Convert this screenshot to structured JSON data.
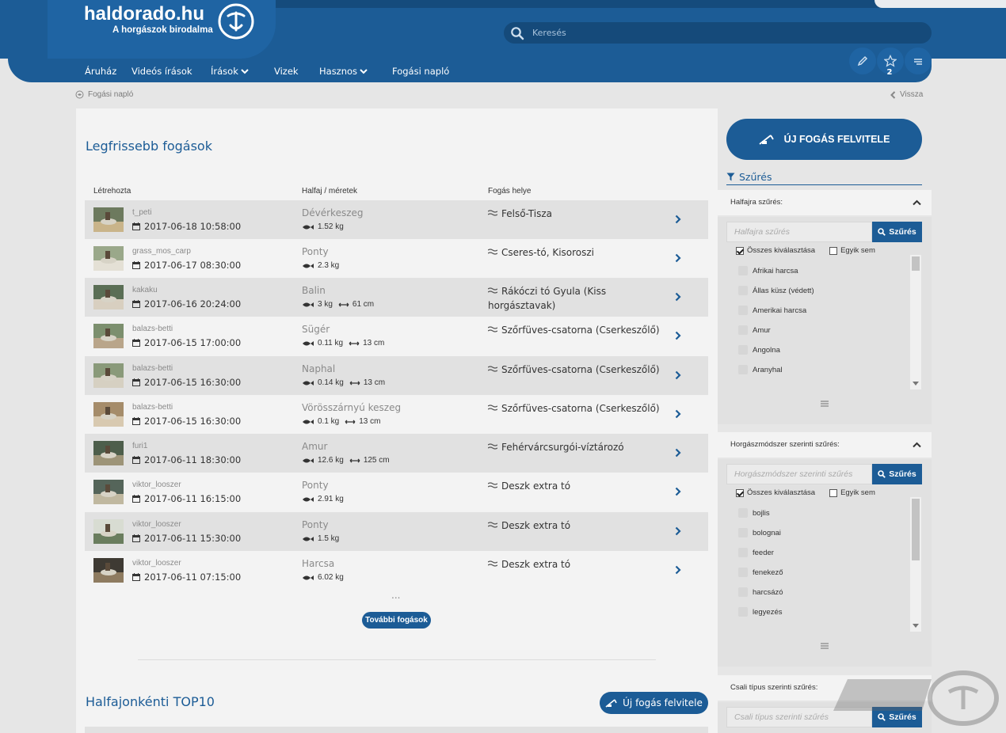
{
  "header": {
    "logo_text": "haldorado.hu",
    "logo_subtitle": "A horgászok birodalma",
    "search_placeholder": "Keresés",
    "nav": [
      "Áruház",
      "Videós írások",
      "Írások",
      "Vizek",
      "Hasznos",
      "Fogási napló"
    ],
    "badge_count": "2"
  },
  "breadcrumb": {
    "current": "Fogási napló",
    "back": "Vissza"
  },
  "catches": {
    "title": "Legfrissebb fogások",
    "columns": {
      "creator": "Létrehozta",
      "species": "Halfaj / méretek",
      "place": "Fogás helye"
    },
    "rows": [
      {
        "user": "t_peti",
        "date": "2017-06-18 10:58:00",
        "species": "Dévérkeszeg",
        "weight": "1.52 kg",
        "length": "",
        "place": "Felső-Tisza"
      },
      {
        "user": "grass_mos_carp",
        "date": "2017-06-17 08:30:00",
        "species": "Ponty",
        "weight": "2.3 kg",
        "length": "",
        "place": "Cseres-tó, Kisoroszi"
      },
      {
        "user": "kakaku",
        "date": "2017-06-16 20:24:00",
        "species": "Balin",
        "weight": "3 kg",
        "length": "61 cm",
        "place": "Rákóczi tó Gyula (Kiss horgásztavak)"
      },
      {
        "user": "balazs-betti",
        "date": "2017-06-15 17:00:00",
        "species": "Sügér",
        "weight": "0.11 kg",
        "length": "13 cm",
        "place": "Szőrfüves-csatorna (Cserkeszőlő)"
      },
      {
        "user": "balazs-betti",
        "date": "2017-06-15 16:30:00",
        "species": "Naphal",
        "weight": "0.14 kg",
        "length": "13 cm",
        "place": "Szőrfüves-csatorna (Cserkeszőlő)"
      },
      {
        "user": "balazs-betti",
        "date": "2017-06-15 16:30:00",
        "species": "Vörösszárnyú keszeg",
        "weight": "0.1 kg",
        "length": "13 cm",
        "place": "Szőrfüves-csatorna (Cserkeszőlő)"
      },
      {
        "user": "furi1",
        "date": "2017-06-11 18:30:00",
        "species": "Amur",
        "weight": "12.6 kg",
        "length": "125 cm",
        "place": "Fehérvárcsurgói-víztározó"
      },
      {
        "user": "viktor_looszer",
        "date": "2017-06-11 16:15:00",
        "species": "Ponty",
        "weight": "2.91 kg",
        "length": "",
        "place": "Deszk extra tó"
      },
      {
        "user": "viktor_looszer",
        "date": "2017-06-11 15:30:00",
        "species": "Ponty",
        "weight": "1.5 kg",
        "length": "",
        "place": "Deszk extra tó"
      },
      {
        "user": "viktor_looszer",
        "date": "2017-06-11 07:15:00",
        "species": "Harcsa",
        "weight": "6.02 kg",
        "length": "",
        "place": "Deszk extra tó"
      }
    ],
    "ellipsis": "...",
    "more_button": "További fogások"
  },
  "top10": {
    "title": "Halfajonkénti TOP10",
    "new_button": "Új fogás felvitele"
  },
  "sidebar": {
    "new_button": "ÚJ FOGÁS FELVITELE",
    "filter_title": "Szűrés",
    "species_filter": {
      "label": "Halfajra szűrés:",
      "placeholder": "Halfajra szűrés",
      "button": "Szűrés",
      "select_all": "Összes kiválasztása",
      "select_none": "Egyik sem",
      "items": [
        "Afrikai harcsa",
        "Állas küsz (védett)",
        "Amerikai harcsa",
        "Amur",
        "Angolna",
        "Aranyhal"
      ]
    },
    "method_filter": {
      "label": "Horgászmódszer szerinti szűrés:",
      "placeholder": "Horgászmódszer szerinti szűrés",
      "button": "Szűrés",
      "select_all": "Összes kiválasztása",
      "select_none": "Egyik sem",
      "items": [
        "bojlis",
        "bolognai",
        "feeder",
        "fenekező",
        "harcsázó",
        "legyezés"
      ]
    },
    "bait_filter": {
      "label": "Csali típus szerinti szűrés:",
      "placeholder": "Csali típus szerinti szűrés",
      "button": "Szűrés"
    }
  },
  "colors": {
    "brand_blue": "#1c5c96",
    "row_gray": "#e1e1e1",
    "panel": "#f3f3f3"
  }
}
